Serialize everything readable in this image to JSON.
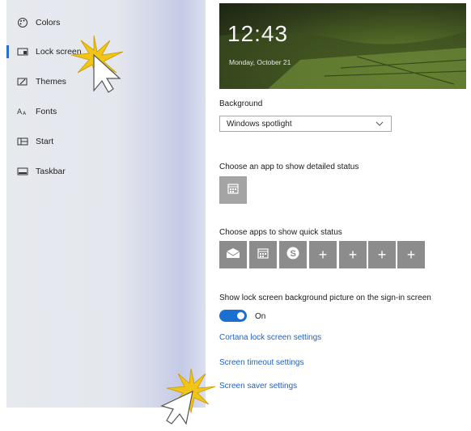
{
  "sidebar": {
    "items": [
      {
        "label": "Colors",
        "icon": "palette-icon"
      },
      {
        "label": "Lock screen",
        "icon": "lock-screen-icon",
        "active": true
      },
      {
        "label": "Themes",
        "icon": "themes-icon"
      },
      {
        "label": "Fonts",
        "icon": "fonts-icon"
      },
      {
        "label": "Start",
        "icon": "start-icon"
      },
      {
        "label": "Taskbar",
        "icon": "taskbar-icon"
      }
    ]
  },
  "preview": {
    "time": "12:43",
    "date": "Monday, October 21"
  },
  "background": {
    "label": "Background",
    "selected": "Windows spotlight"
  },
  "detailed_status": {
    "label": "Choose an app to show detailed status",
    "app_icon": "calendar-icon"
  },
  "quick_status": {
    "label": "Choose apps to show quick status",
    "apps": [
      "mail-icon",
      "calendar-icon",
      "skype-icon",
      "plus-icon",
      "plus-icon",
      "plus-icon",
      "plus-icon"
    ],
    "plus_text": "+"
  },
  "signin": {
    "label": "Show lock screen background picture on the sign-in screen",
    "toggle_state": "On"
  },
  "links": {
    "cortana": "Cortana lock screen settings",
    "timeout": "Screen timeout settings",
    "saver": "Screen saver settings"
  },
  "colors": {
    "accent": "#1a6fd0",
    "link": "#1e62c0"
  }
}
